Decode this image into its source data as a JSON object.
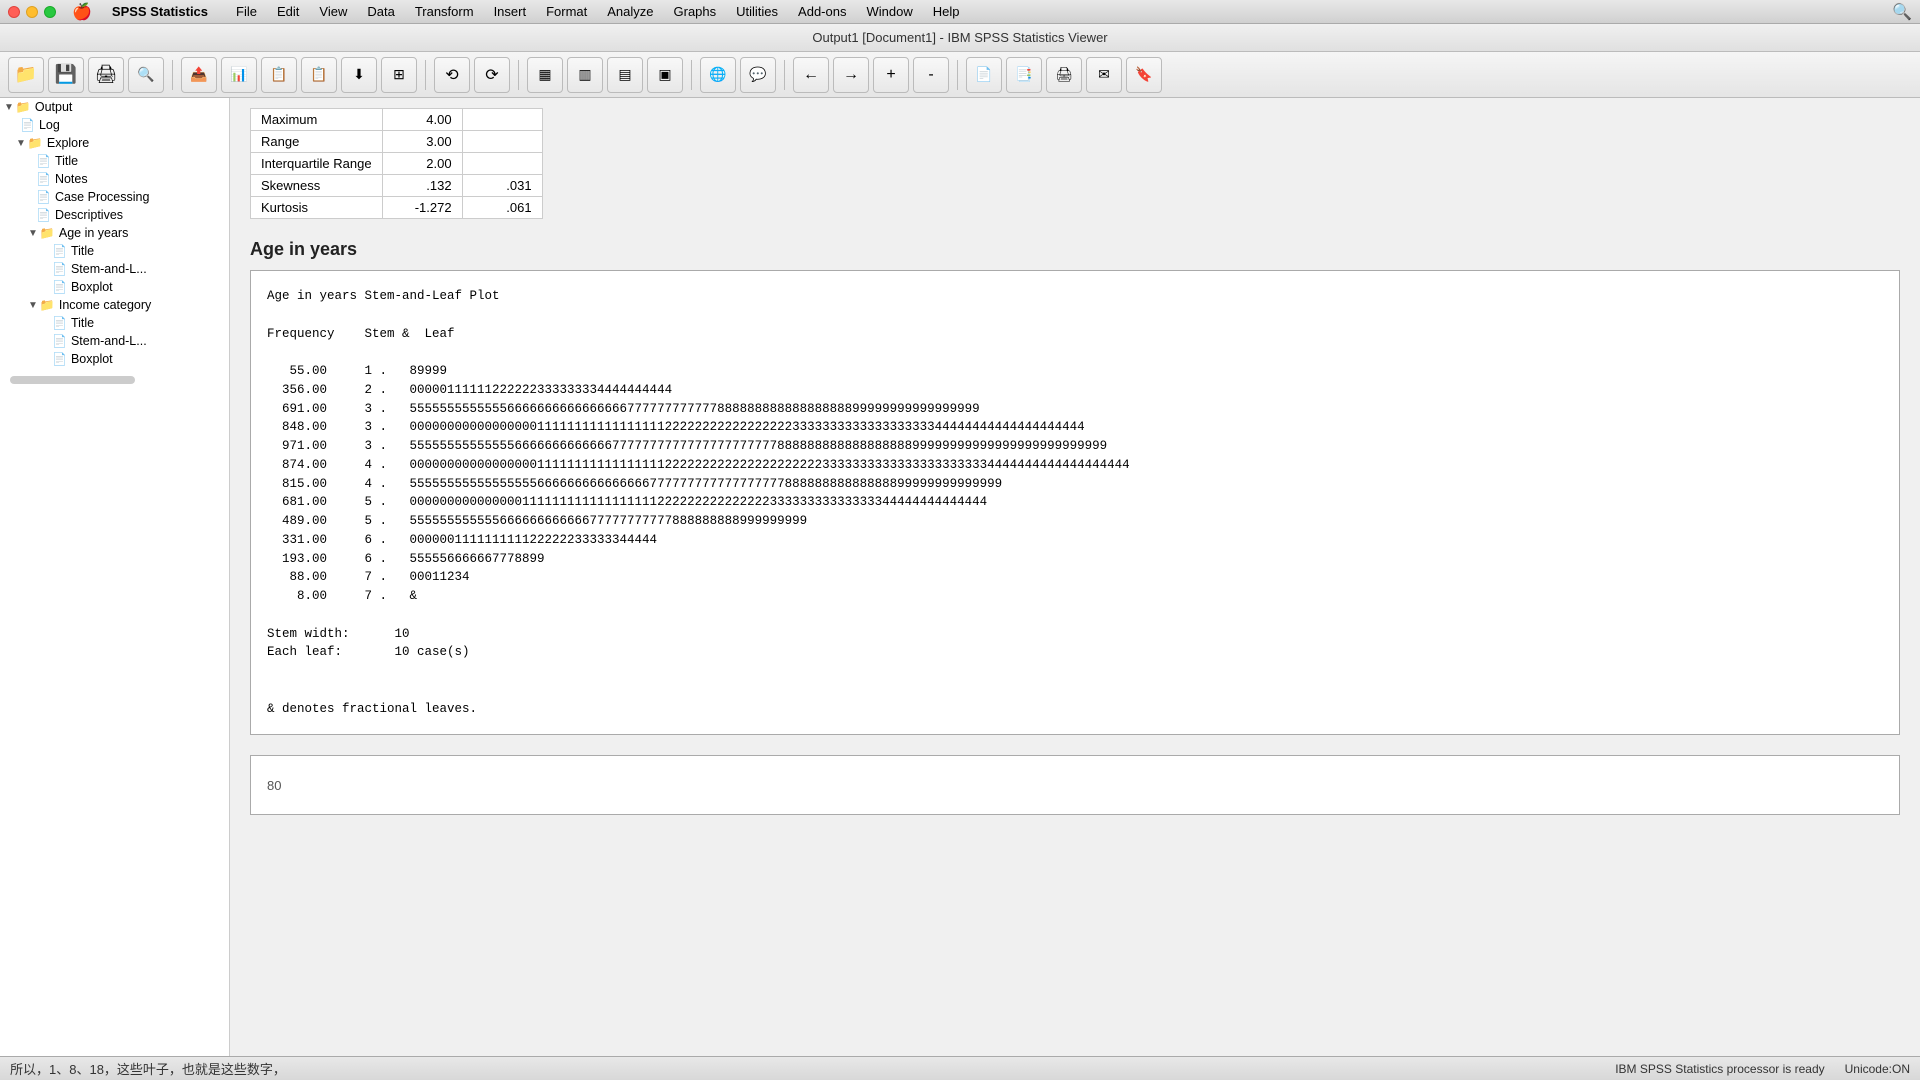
{
  "app": {
    "name": "SPSS Statistics",
    "title": "Output1 [Document1] - IBM SPSS Statistics Viewer"
  },
  "menubar": {
    "apple": "🍎",
    "items": [
      "SPSS Statistics",
      "File",
      "Edit",
      "View",
      "Data",
      "Transform",
      "Insert",
      "Format",
      "Analyze",
      "Graphs",
      "Utilities",
      "Add-ons",
      "Window",
      "Help"
    ]
  },
  "toolbar": {
    "buttons": [
      "📁",
      "💾",
      "🖨",
      "🔍",
      "📋",
      "📊",
      "📋",
      "📋",
      "⬇",
      "📋",
      "🔄",
      "⟲",
      "⟳",
      "📊",
      "📊",
      "📊",
      "📊",
      "⬇",
      "🌐",
      "💬",
      "📋",
      "📋",
      "📋",
      "📋",
      "📋",
      "📋",
      "←",
      "→",
      "+",
      "-",
      "📋",
      "📋",
      "📋",
      "📋",
      "📋",
      "📋"
    ]
  },
  "sidebar": {
    "items": [
      {
        "id": "output",
        "label": "Output",
        "level": 0,
        "type": "folder",
        "expanded": true
      },
      {
        "id": "log",
        "label": "Log",
        "level": 1,
        "type": "doc"
      },
      {
        "id": "explore",
        "label": "Explore",
        "level": 1,
        "type": "folder",
        "expanded": true
      },
      {
        "id": "title",
        "label": "Title",
        "level": 2,
        "type": "doc"
      },
      {
        "id": "notes",
        "label": "Notes",
        "level": 2,
        "type": "doc"
      },
      {
        "id": "case-processing",
        "label": "Case Processing",
        "level": 2,
        "type": "doc"
      },
      {
        "id": "descriptives",
        "label": "Descriptives",
        "level": 2,
        "type": "doc"
      },
      {
        "id": "age-in-years",
        "label": "Age in years",
        "level": 2,
        "type": "folder",
        "expanded": true
      },
      {
        "id": "age-title",
        "label": "Title",
        "level": 3,
        "type": "doc"
      },
      {
        "id": "stem-and-leaf",
        "label": "Stem-and-L...",
        "level": 3,
        "type": "doc"
      },
      {
        "id": "boxplot",
        "label": "Boxplot",
        "level": 3,
        "type": "doc"
      },
      {
        "id": "income-category",
        "label": "Income category",
        "level": 2,
        "type": "folder",
        "expanded": true
      },
      {
        "id": "income-title",
        "label": "Title",
        "level": 3,
        "type": "doc"
      },
      {
        "id": "income-stem",
        "label": "Stem-and-L...",
        "level": 3,
        "type": "doc"
      },
      {
        "id": "income-boxplot",
        "label": "Boxplot",
        "level": 3,
        "type": "doc"
      }
    ]
  },
  "stats_table": {
    "rows": [
      {
        "label": "Maximum",
        "val1": "4.00",
        "val2": ""
      },
      {
        "label": "Range",
        "val1": "3.00",
        "val2": ""
      },
      {
        "label": "Interquartile Range",
        "val1": "2.00",
        "val2": ""
      },
      {
        "label": "Skewness",
        "val1": ".132",
        "val2": ".031"
      },
      {
        "label": "Kurtosis",
        "val1": "-1.272",
        "val2": ".061"
      }
    ]
  },
  "age_section": {
    "heading": "Age in years"
  },
  "stem_leaf": {
    "title": "Age in years Stem-and-Leaf Plot",
    "header": "Frequency    Stem &  Leaf",
    "rows": [
      {
        "freq": "   55.00",
        "stem": " 1",
        "leaf": "89999"
      },
      {
        "freq": "  356.00",
        "stem": " 2",
        "leaf": "00000111111222222333333334444444444"
      },
      {
        "freq": "  691.00",
        "stem": " 3",
        "leaf": "5555555555555666666666666666677777777777788888888888888888899999999999999999"
      },
      {
        "freq": "  848.00",
        "stem": " 3",
        "leaf": "000000000000000001111111111111111122222222222222222333333333333333333344444444444444444444"
      },
      {
        "freq": "  971.00",
        "stem": " 3",
        "leaf": "555555555555556666666666666777777777777777777777788888888888888888899999999999999999999999999"
      },
      {
        "freq": "  874.00",
        "stem": " 4",
        "leaf": "000000000000000001111111111111111122222222222222222222233333333333333333333334444444444444444444"
      },
      {
        "freq": "  815.00",
        "stem": " 4",
        "leaf": "5555555555555555566666666666666677777777777777777788888888888888899999999999999"
      },
      {
        "freq": "  681.00",
        "stem": " 5",
        "leaf": "00000000000000011111111111111111122222222222222233333333333333344444444444444"
      },
      {
        "freq": "  489.00",
        "stem": " 5",
        "leaf": "55555555555566666666666677777777777888888888999999999"
      },
      {
        "freq": "  331.00",
        "stem": " 6",
        "leaf": "000000111111111122222233333344444"
      },
      {
        "freq": "  193.00",
        "stem": " 6",
        "leaf": "555556666667778899"
      },
      {
        "freq": "   88.00",
        "stem": " 7",
        "leaf": "00011234"
      },
      {
        "freq": "    8.00",
        "stem": " 7",
        "leaf": "&"
      }
    ],
    "stem_width": "Stem width:      10",
    "each_leaf": "Each leaf:       10 case(s)",
    "note": "& denotes fractional leaves."
  },
  "statusbar": {
    "left": "所以，1、8、18，这些叶子，也就是这些数字，",
    "right": "IBM SPSS Statistics processor is ready",
    "encoding": "Unicode:ON"
  }
}
